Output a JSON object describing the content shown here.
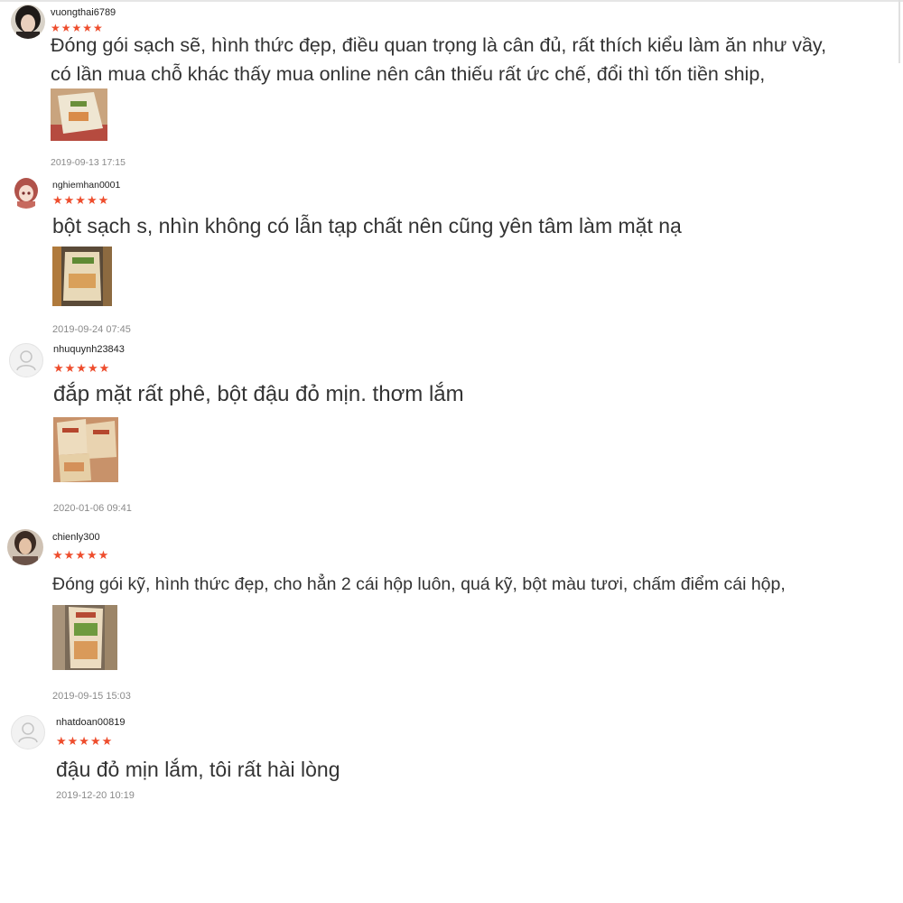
{
  "reviews": [
    {
      "username": "vuongthai6789",
      "rating": 5,
      "stars": "★★★★★",
      "avatar": "user-photo-avatar",
      "comment_lines": [
        "Đóng gói sạch sẽ, hình thức đẹp, điều quan trọng là cân đủ, rất thích kiểu làm ăn như vầy,",
        "có lần mua chỗ khác thấy mua online nên cân thiếu rất ức chế, đổi thì tốn tiền ship,"
      ],
      "date": "2019-09-13 17:15"
    },
    {
      "username": "nghiemhan0001",
      "rating": 5,
      "stars": "★★★★★",
      "avatar": "anime-girl-avatar",
      "comment_lines": [
        "bột sạch s, nhìn không có lẫn tạp chất nên cũng yên tâm làm mặt nạ"
      ],
      "date": "2019-09-24 07:45"
    },
    {
      "username": "nhuquynh23843",
      "rating": 5,
      "stars": "★★★★★",
      "avatar": "default-user-icon",
      "comment_lines": [
        "đắp mặt rất phê, bột đậu đỏ mịn. thơm lắm"
      ],
      "date": "2020-01-06 09:41"
    },
    {
      "username": "chienly300",
      "rating": 5,
      "stars": "★★★★★",
      "avatar": "user-photo-avatar",
      "comment_lines": [
        "Đóng gói kỹ, hình thức đẹp, cho hẳn 2 cái hộp luôn, quá kỹ, bột màu tươi, chấm điểm cái hộp,"
      ],
      "date": "2019-09-15 15:03"
    },
    {
      "username": "nhatdoan00819",
      "rating": 5,
      "stars": "★★★★★",
      "avatar": "default-user-icon",
      "comment_lines": [
        "đậu đỏ mịn lắm, tôi rất hài lòng"
      ],
      "date": "2019-12-20 10:19"
    }
  ],
  "colors": {
    "star": "#ee4d2d",
    "date": "#8a8a8a",
    "text": "#333333"
  }
}
